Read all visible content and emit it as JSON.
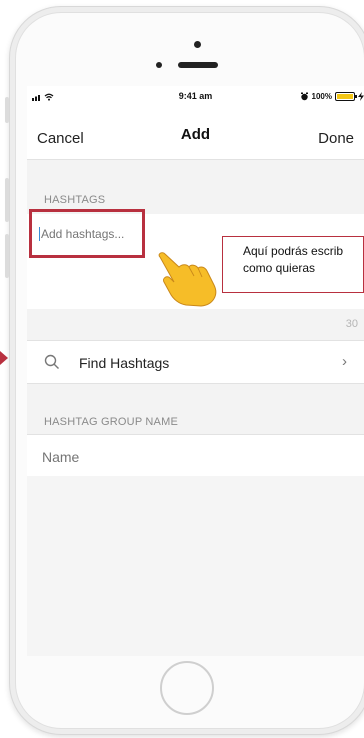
{
  "status_bar": {
    "time": "9:41 am",
    "battery": "100%"
  },
  "nav": {
    "cancel_label": "Cancel",
    "title": "Add",
    "done_label": "Done"
  },
  "hashtags": {
    "section_label": "HASHTAGS",
    "placeholder": "Add hashtags...",
    "char_count": "30"
  },
  "find": {
    "label": "Find Hashtags",
    "chevron": "›"
  },
  "group": {
    "section_label": "HASHTAG GROUP NAME",
    "placeholder": "Name"
  },
  "callout": {
    "line1": "Aquí podrás escrib",
    "line2": "como quieras"
  },
  "icons": {
    "signal": "signal-icon",
    "wifi": "wifi-icon",
    "alarm": "alarm-icon",
    "battery": "battery-icon",
    "charging": "charging-icon",
    "search": "search-icon",
    "pointing_hand": "pointing-hand-icon"
  },
  "colors": {
    "highlight": "#b8303f",
    "battery": "#f3c614",
    "hand": "#f6bd28"
  }
}
